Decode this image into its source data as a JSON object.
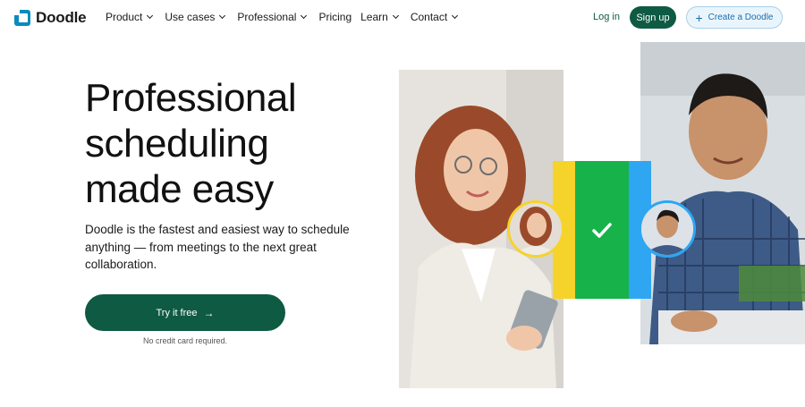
{
  "brand": {
    "name": "Doodle"
  },
  "nav": {
    "items": [
      {
        "label": "Product",
        "has_dropdown": true
      },
      {
        "label": "Use cases",
        "has_dropdown": true
      },
      {
        "label": "Professional",
        "has_dropdown": true
      },
      {
        "label": "Pricing",
        "has_dropdown": false
      },
      {
        "label": "Learn",
        "has_dropdown": true
      },
      {
        "label": "Contact",
        "has_dropdown": true
      }
    ],
    "login_label": "Log in",
    "signup_label": "Sign up",
    "create_label": "Create a Doodle"
  },
  "hero": {
    "title_lines": [
      "Professional",
      "scheduling",
      "made easy"
    ],
    "description": "Doodle is the fastest and easiest way to schedule anything — from meetings to the next great collaboration.",
    "cta_label": "Try it free",
    "cta_note": "No credit card required."
  },
  "colors": {
    "brand_green": "#0e5a43",
    "bar_yellow": "#f6d32a",
    "bar_green": "#17b34a",
    "bar_blue": "#2ea6f2",
    "create_bg": "#e9f5fd"
  },
  "icons": {
    "logo": "doodle-logo-icon",
    "chevron": "chevron-down-icon",
    "plus": "plus-icon",
    "arrow": "arrow-right-icon",
    "check": "check-icon"
  }
}
